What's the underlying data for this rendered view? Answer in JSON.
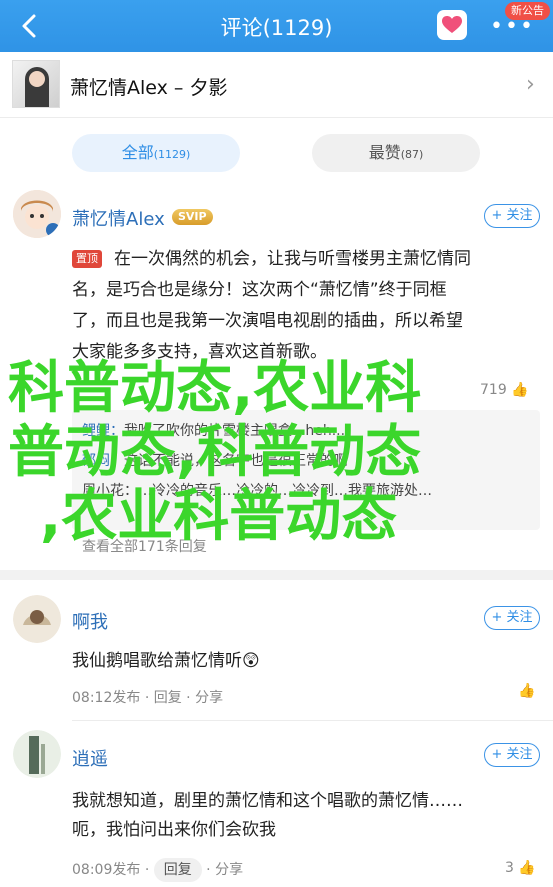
{
  "header": {
    "title": "评论(1129)",
    "notice_badge": "新公告"
  },
  "song": {
    "title": "萧忆情Alex – 夕影"
  },
  "tabs": [
    {
      "label": "全部",
      "count": "(1129)"
    },
    {
      "label": "最赞",
      "count": "(87)"
    }
  ],
  "comments": [
    {
      "user": "萧忆情Alex",
      "badge": "SVIP",
      "follow": "+ 关注",
      "pin_tag": "置顶",
      "lines": [
        "在一次偶然的机会，让我与听雪楼男主萧忆情同",
        "名，是巧合也是缘分！这次两个“萧忆情”终于同框",
        "了，而且也是我第一次演唱电视剧的插曲，所以希望",
        "大家能多多支持，喜欢这首新歌。"
      ],
      "like_count": "719",
      "sub_replies": [
        {
          "user": "鲤鲤：",
          "text": "我吹了吹你的片雪楼主唱盒...heh..."
        },
        {
          "user": "郁闷：",
          "text": "这话不能说，这名字也是很正常的啊"
        },
        {
          "user": "",
          "text": "周小花：…冷冷的音乐…冷冷的…冷冷到…我要旅游处…"
        }
      ],
      "sub_footer": "查看全部171条回复"
    },
    {
      "user": "啊我",
      "follow": "+ 关注",
      "text": "我仙鹅唱歌给萧忆情听😲",
      "time": "08:12发布",
      "reply": "回复",
      "share": "分享"
    },
    {
      "user": "逍遥",
      "follow": "+ 关注",
      "lines": [
        "我就想知道，剧里的萧忆情和这个唱歌的萧忆情……",
        "呃，我怕问出来你们会砍我"
      ],
      "time": "08:09发布",
      "reply": "回复",
      "share": "分享",
      "like_count": "3"
    }
  ],
  "watermark": {
    "line1": "科普动态,农业科",
    "line2": "普动态,科普动态",
    "line3": ",农业科普动态"
  },
  "colors": {
    "header": "#2f93e6",
    "accent": "#2f8ee5",
    "watermark": "#3bd62b"
  }
}
